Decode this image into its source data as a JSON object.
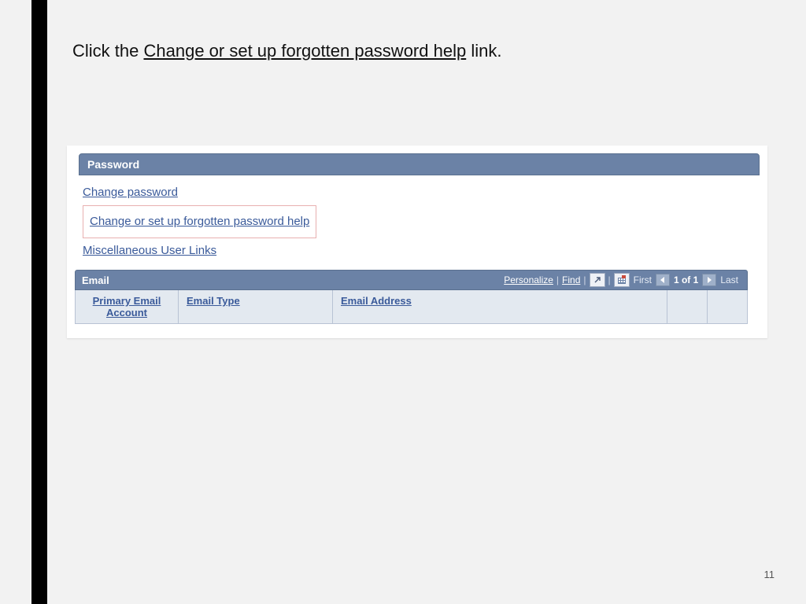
{
  "instruction": {
    "prefix": "Click the ",
    "link_text": "Change or set up forgotten password help",
    "suffix": " link."
  },
  "page_number": "11",
  "password_section": {
    "title": "Password",
    "links": {
      "change_password": "Change password",
      "forgotten_help": "Change or set up forgotten password help",
      "misc": "Miscellaneous User Links"
    }
  },
  "email_section": {
    "title": "Email",
    "toolbar": {
      "personalize": "Personalize",
      "find": "Find",
      "first": "First",
      "counter": "1 of 1",
      "last": "Last"
    },
    "columns": {
      "primary": "Primary Email Account",
      "type": "Email Type",
      "address": "Email Address"
    }
  }
}
